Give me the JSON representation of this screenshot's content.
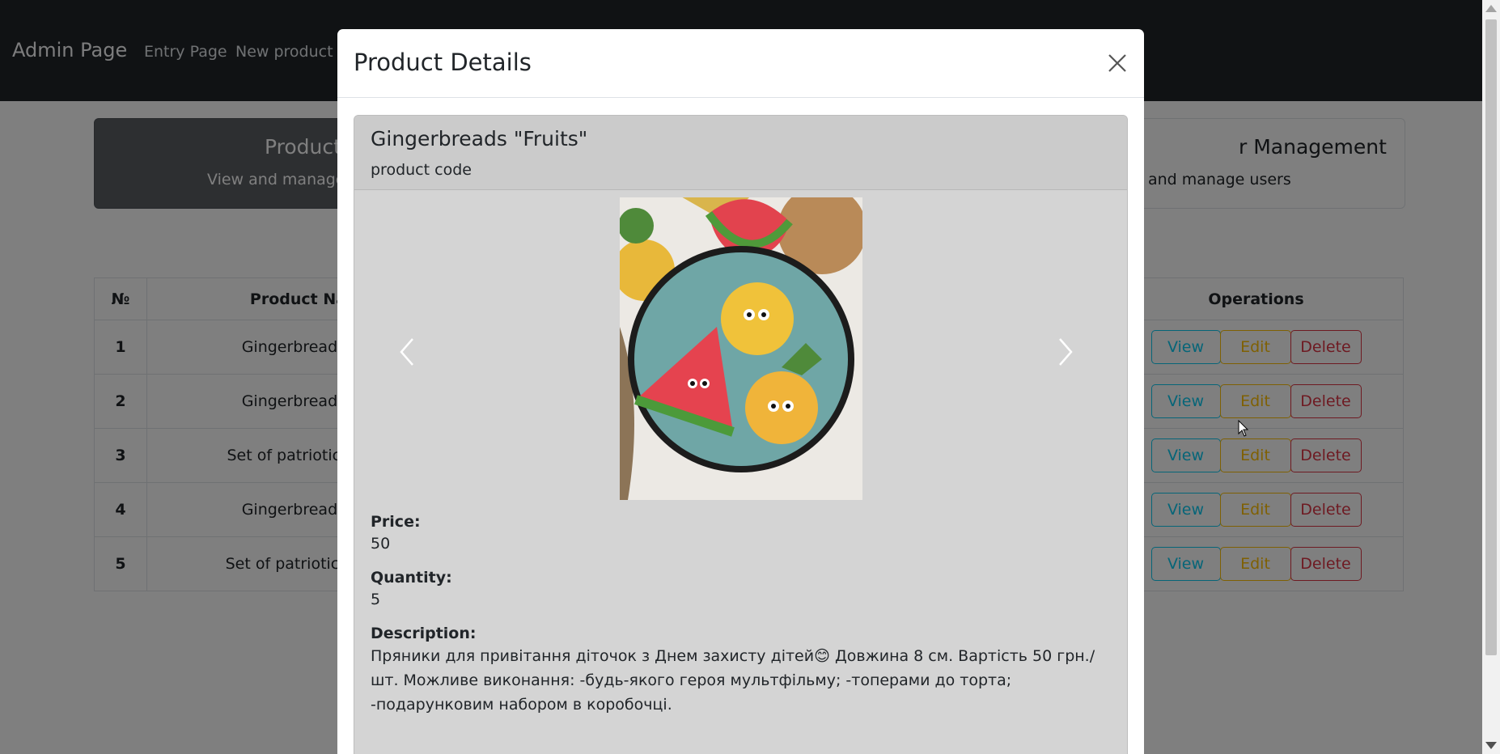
{
  "navbar": {
    "brand": "Admin Page",
    "links": [
      "Entry Page",
      "New product"
    ]
  },
  "cards": {
    "products": {
      "title": "Product",
      "text": "View and manage"
    },
    "users": {
      "title": "r Management",
      "text": "and manage users"
    }
  },
  "table": {
    "headers": {
      "num": "№",
      "name": "Product Na",
      "ops": "Operations"
    },
    "rows": [
      {
        "num": "1",
        "name": "Gingerbreads '"
      },
      {
        "num": "2",
        "name": "Gingerbreads '"
      },
      {
        "num": "3",
        "name": "Set of patriotic gin"
      },
      {
        "num": "4",
        "name": "Gingerbreads '"
      },
      {
        "num": "5",
        "name": "Set of patriotic cak"
      }
    ],
    "buttons": {
      "view": "View",
      "edit": "Edit",
      "delete": "Delete"
    }
  },
  "modal": {
    "title": "Product Details",
    "product_title": "Gingerbreads \"Fruits\"",
    "product_code": "product code",
    "price_label": "Price:",
    "price": "50",
    "quantity_label": "Quantity:",
    "quantity": "5",
    "description_label": "Description:",
    "description": "Пряники для привітання діточок з Днем захисту дітей😊 Довжина 8 см. Вартість 50 грн./шт. Можливе виконання: -будь-якого героя мультфільму; -топерами до торта; -подарунковим набором в коробочці."
  },
  "colors": {
    "navbar": "#212529",
    "view": "#0dcaf0",
    "edit": "#ffc107",
    "delete": "#dc3545"
  }
}
